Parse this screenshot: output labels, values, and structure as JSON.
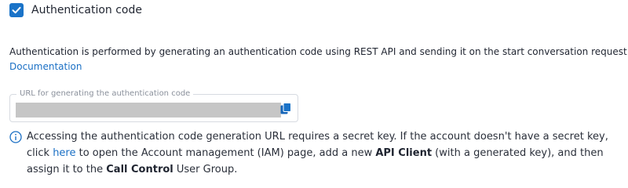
{
  "auth_checkbox": {
    "checked": true,
    "label": "Authentication code"
  },
  "description": {
    "text": "Authentication is performed by generating an authentication code using REST API and sending it on the start conversation request (SIP h",
    "doc_link": "Documentation"
  },
  "url_field": {
    "label": "URL for generating the authentication code",
    "value_redacted": true,
    "copy_icon": "copy-icon"
  },
  "info_note": {
    "icon": "info-icon",
    "part1": "Accessing the authentication code generation URL requires a secret key. If the account doesn't have a secret key, click ",
    "link": "here",
    "part2": " to open the Account management (IAM) page, add a new ",
    "api_client": "API Client",
    "part3": " (with a generated key), and then assign it to the ",
    "call_control": "Call Control",
    "part4": " User Group."
  },
  "colors": {
    "accent": "#1a73c8",
    "link": "#1a6fc4",
    "redaction": "#c6c6c6"
  }
}
